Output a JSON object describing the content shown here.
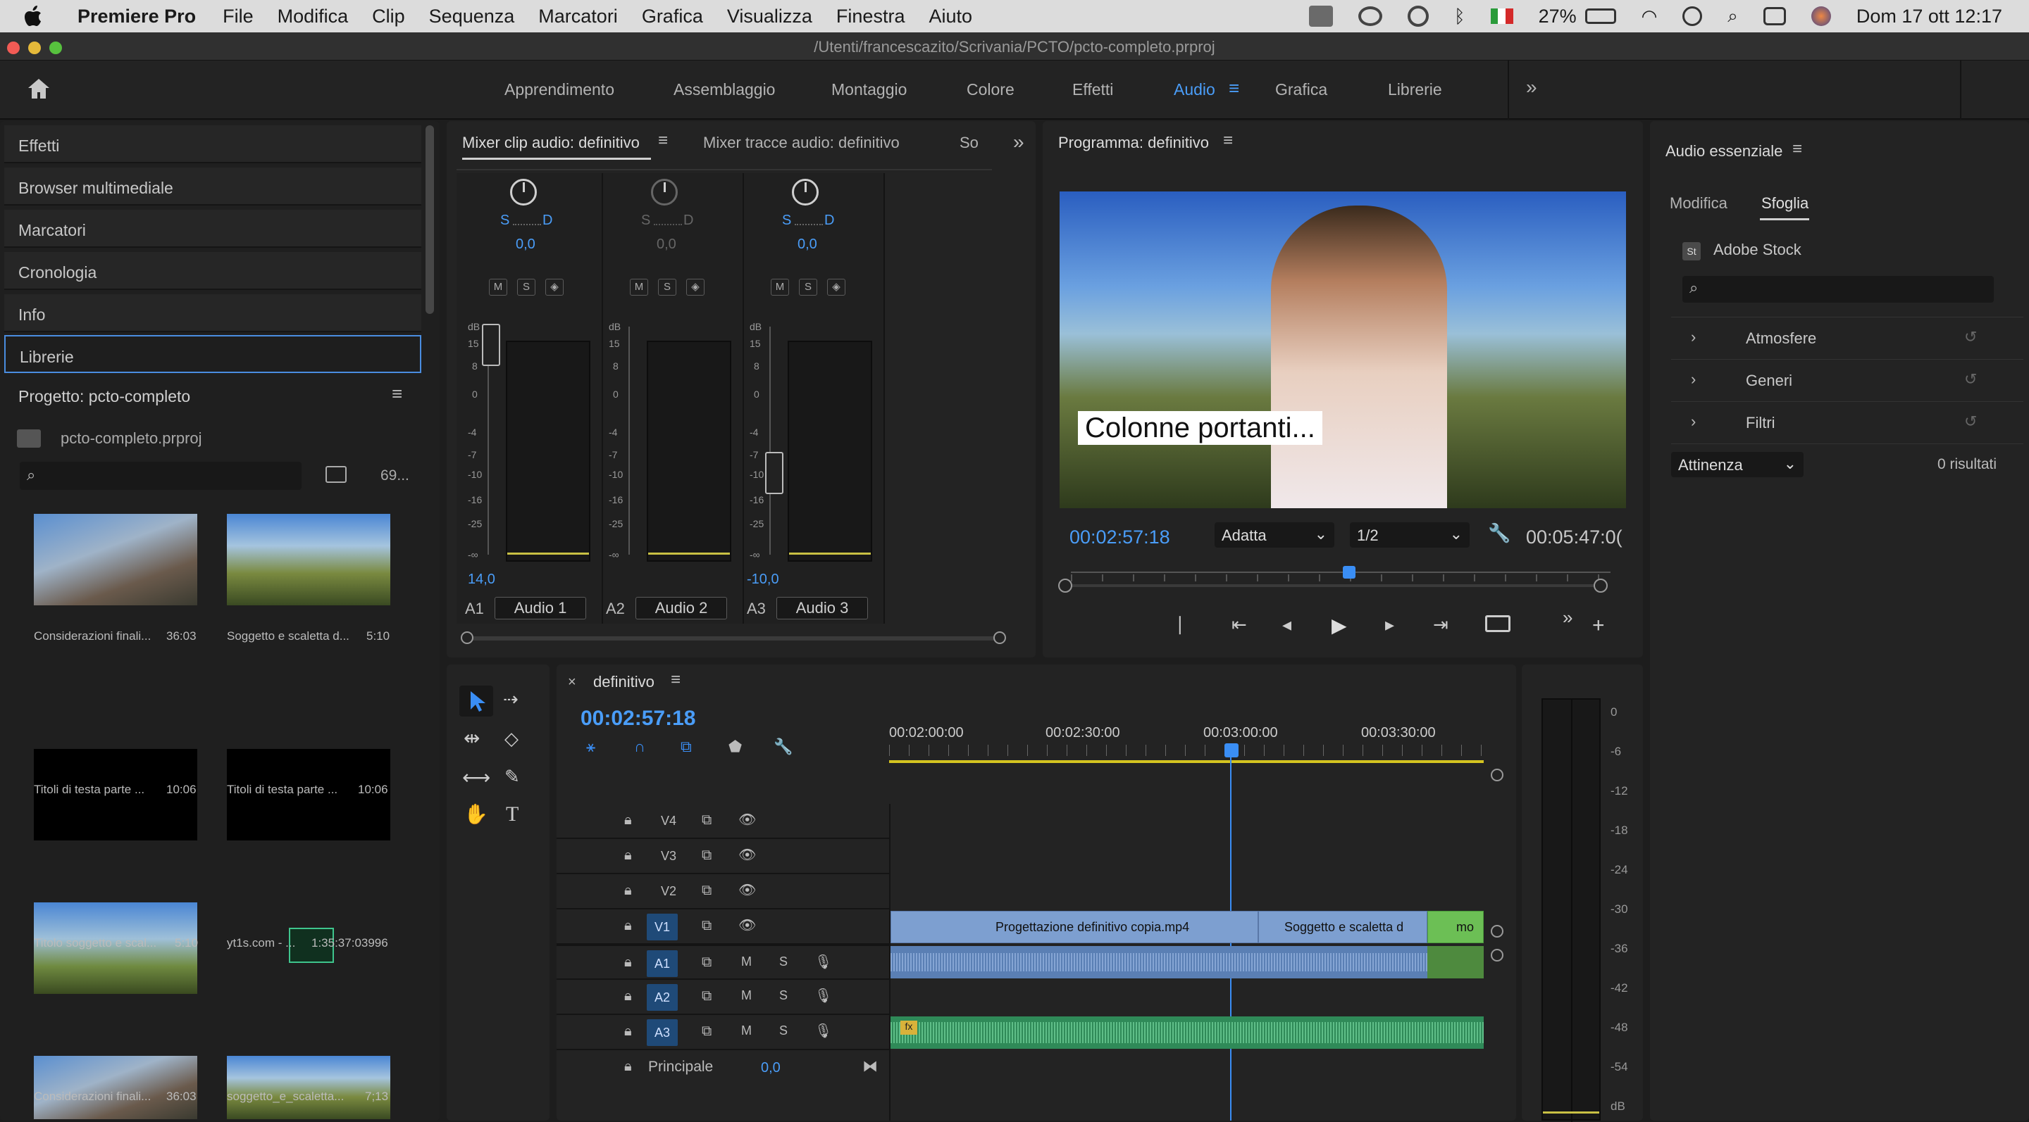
{
  "menubar": {
    "app": "Premiere Pro",
    "items": [
      "File",
      "Modifica",
      "Clip",
      "Sequenza",
      "Marcatori",
      "Grafica",
      "Visualizza",
      "Finestra",
      "Aiuto"
    ],
    "battery": "27%",
    "datetime": "Dom 17 ott  12:17"
  },
  "window": {
    "path": "/Utenti/francescazito/Scrivania/PCTO/pcto-completo.prproj"
  },
  "workspaces": [
    "Apprendimento",
    "Assemblaggio",
    "Montaggio",
    "Colore",
    "Effetti",
    "Audio",
    "Grafica",
    "Librerie"
  ],
  "left": {
    "items": [
      "Effetti",
      "Browser multimediale",
      "Marcatori",
      "Cronologia",
      "Info",
      "Librerie"
    ],
    "project_title": "Progetto: pcto-completo",
    "project_file": "pcto-completo.prproj",
    "count": "69...",
    "bins": [
      {
        "name": "Considerazioni finali...",
        "dur": "36:03"
      },
      {
        "name": "Soggetto e scaletta d...",
        "dur": "5:10"
      },
      {
        "name": "Titoli di testa parte ...",
        "dur": "10:06"
      },
      {
        "name": "Titoli di testa parte ...",
        "dur": "10:06"
      },
      {
        "name": "Titolo soggetto e scal...",
        "dur": "5:10"
      },
      {
        "name": "yt1s.com - ...",
        "dur": "1:35:37:03996"
      },
      {
        "name": "Considerazioni finali...",
        "dur": "36:03"
      },
      {
        "name": "soggetto_e_scaletta...",
        "dur": "7;13"
      }
    ]
  },
  "mixer": {
    "tabs": [
      "Mixer clip audio: definitivo",
      "Mixer tracce audio: definitivo",
      "So"
    ],
    "channels": [
      {
        "pan": "0,0",
        "vol": "14,0",
        "id": "A1",
        "name": "Audio 1"
      },
      {
        "pan": "0,0",
        "vol": "",
        "id": "A2",
        "name": "Audio 2"
      },
      {
        "pan": "0,0",
        "vol": "-10,0",
        "id": "A3",
        "name": "Audio 3"
      }
    ],
    "sd": [
      "S",
      "D"
    ],
    "buttons": [
      "M",
      "S"
    ],
    "scale": [
      "dB",
      "15",
      "8",
      "0",
      "-4",
      "-7",
      "-10",
      "-16",
      "-25",
      "-∞"
    ]
  },
  "program": {
    "title": "Programma: definitivo",
    "caption": "Colonne portanti...",
    "timecode": "00:02:57:18",
    "fit": "Adatta",
    "res": "1/2",
    "duration": "00:05:47:0("
  },
  "essential": {
    "title": "Audio essenziale",
    "tabs": [
      "Modifica",
      "Sfoglia"
    ],
    "stock": "Adobe Stock",
    "categories": [
      "Atmosfere",
      "Generi",
      "Filtri"
    ],
    "sort": "Attinenza",
    "results": "0 risultati"
  },
  "timeline": {
    "tab": "definitivo",
    "timecode": "00:02:57:18",
    "ruler": [
      "00:02:00:00",
      "00:02:30:00",
      "00:03:00:00",
      "00:03:30:00"
    ],
    "tracks": [
      "V4",
      "V3",
      "V2",
      "V1",
      "A1",
      "A2",
      "A3"
    ],
    "master": "Principale",
    "master_val": "0,0",
    "clips": [
      "Progettazione definitivo copia.mp4",
      "Soggetto e scaletta d",
      "mo"
    ]
  },
  "meter_scale": [
    "0",
    "-6",
    "-12",
    "-18",
    "-24",
    "-30",
    "-36",
    "-42",
    "-48",
    "-54",
    "dB"
  ]
}
